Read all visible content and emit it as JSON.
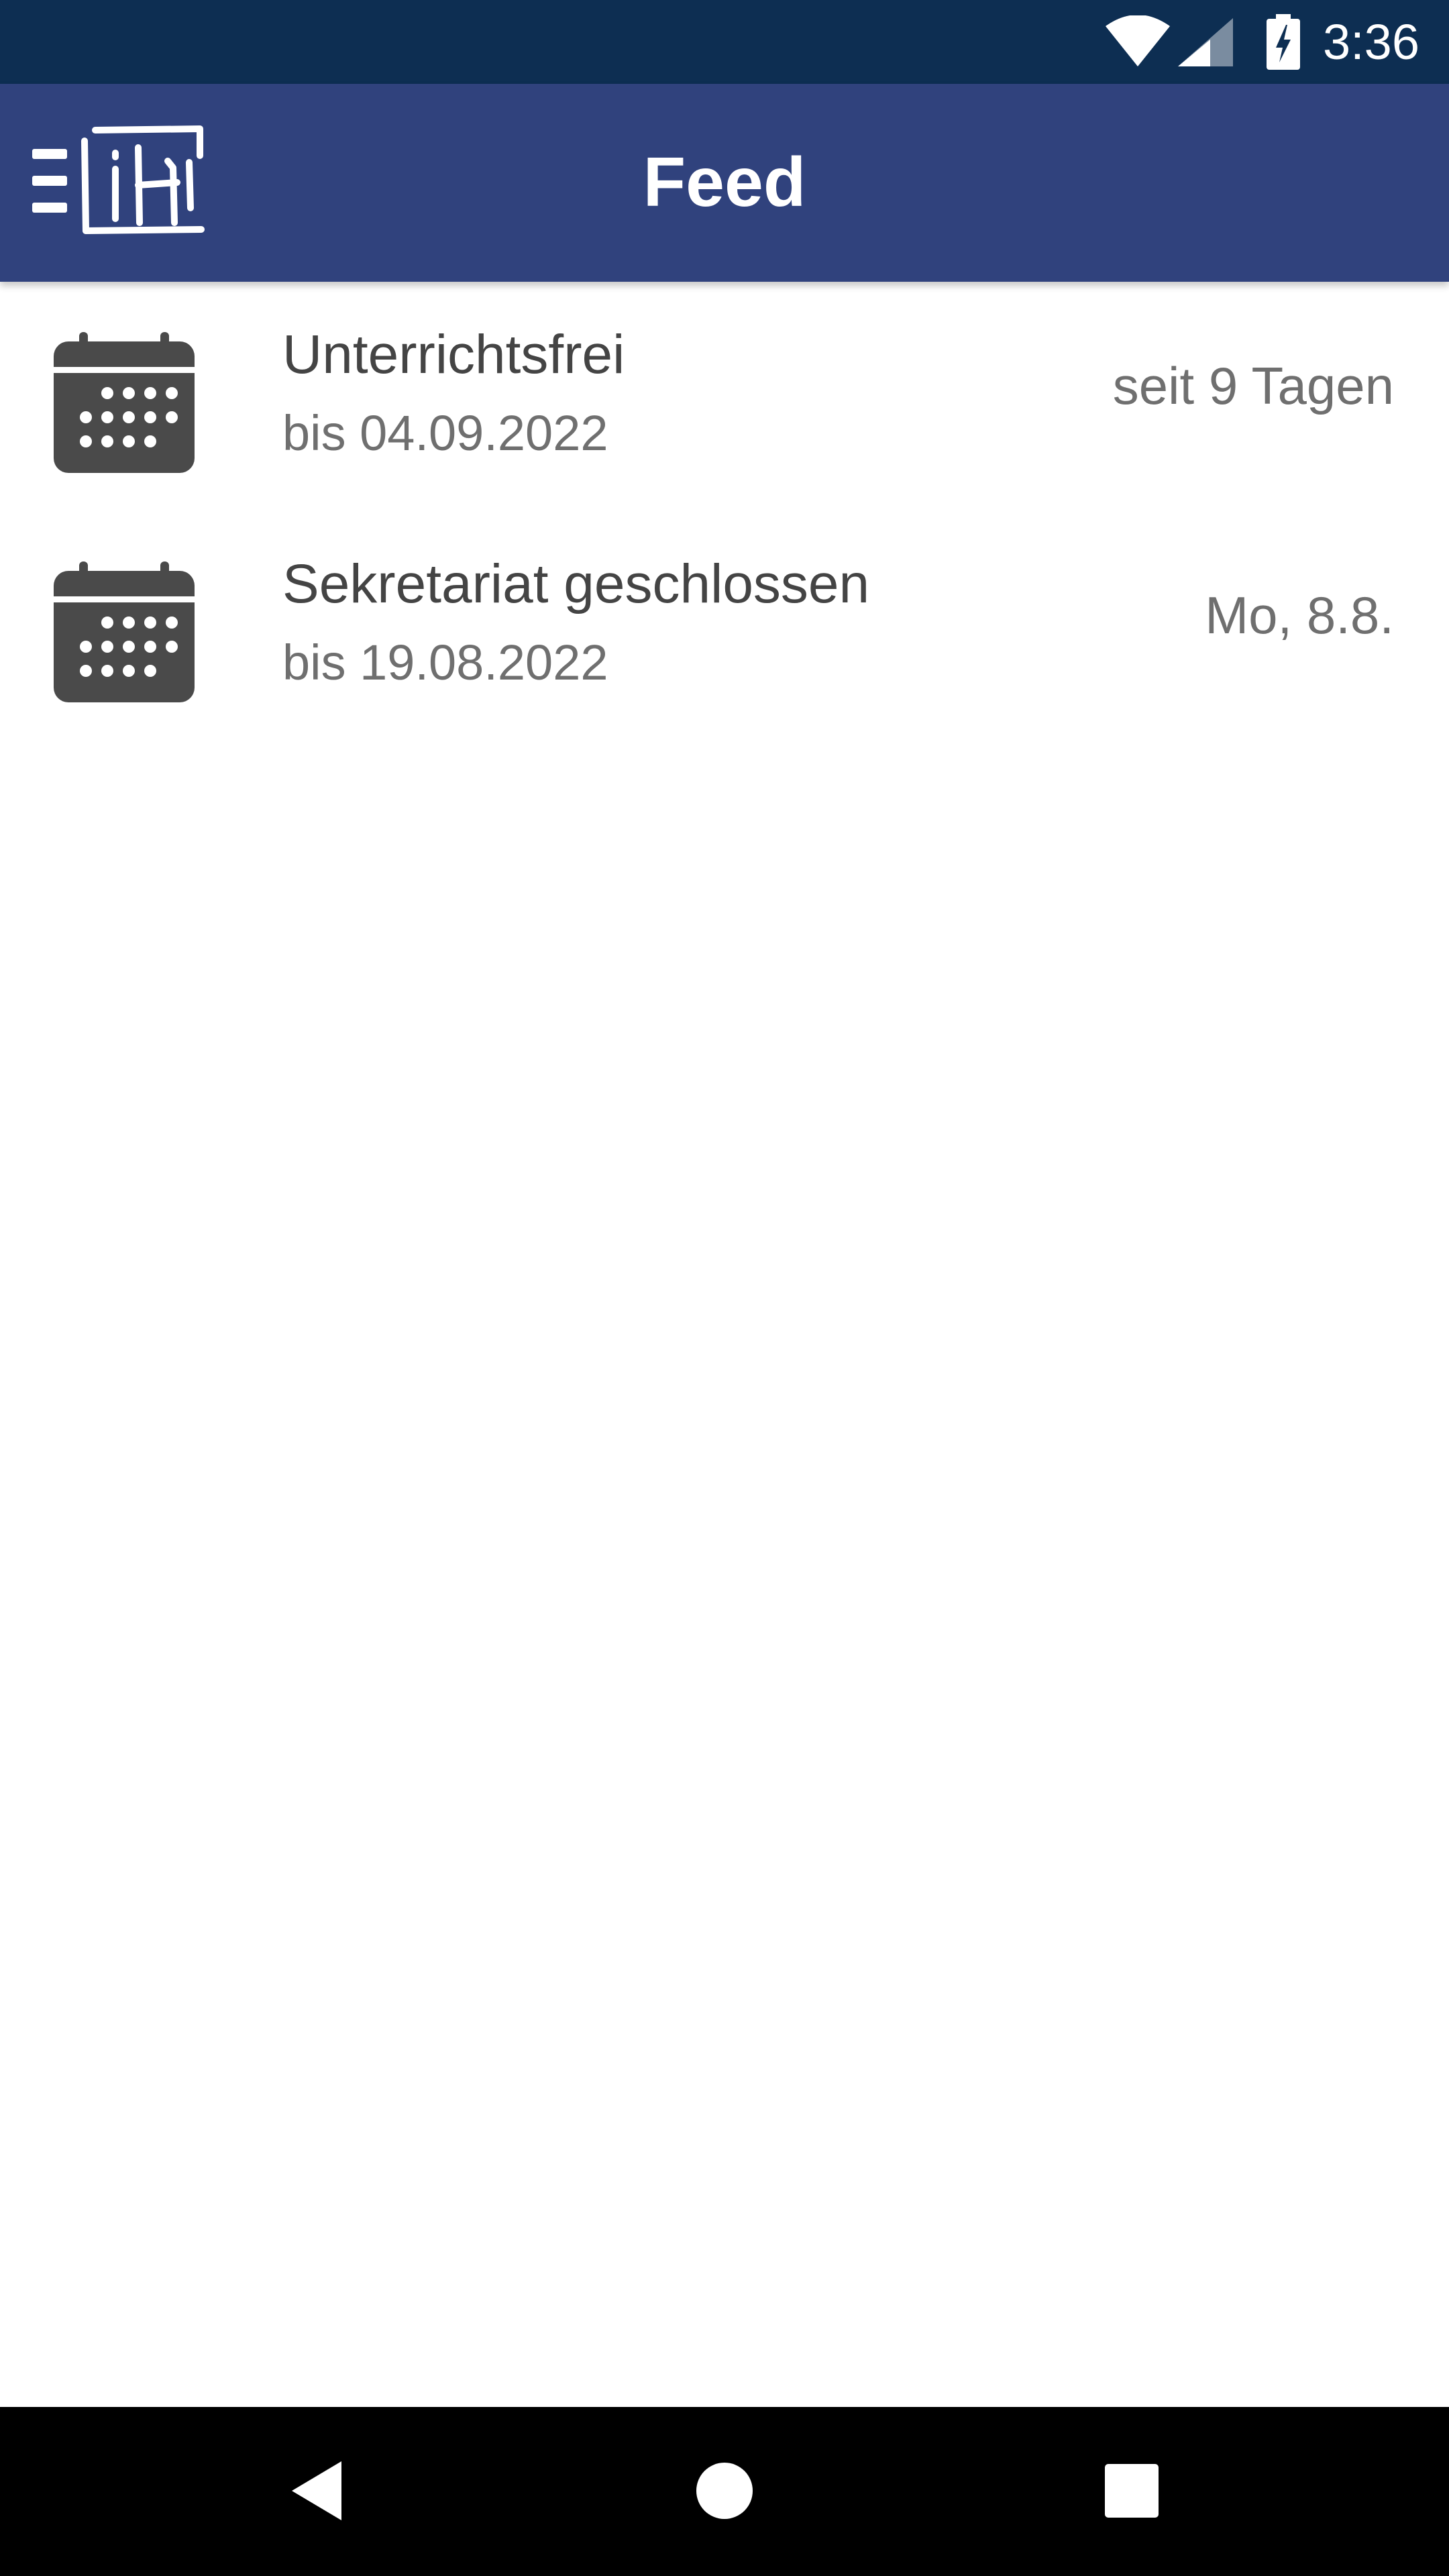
{
  "status_bar": {
    "time": "3:36",
    "icons": [
      "wifi-icon",
      "signal-icon",
      "battery-charging-icon"
    ]
  },
  "app_bar": {
    "title": "Feed",
    "menu_icon": "menu-icon",
    "logo": "school-logo"
  },
  "feed": {
    "items": [
      {
        "icon": "calendar-icon",
        "title": "Unterrichtsfrei",
        "subtitle": "bis 04.09.2022",
        "date": "seit 9 Tagen"
      },
      {
        "icon": "calendar-icon",
        "title": "Sekretariat geschlossen",
        "subtitle": "bis 19.08.2022",
        "date": "Mo, 8.8."
      }
    ]
  },
  "nav_bar": {
    "buttons": [
      "back-icon",
      "home-icon",
      "recents-icon"
    ]
  },
  "colors": {
    "status_bar": "#0d2e52",
    "app_bar": "#30427d",
    "icon": "#4a4a4a",
    "title_text": "#444444",
    "secondary_text": "#6f6f6f"
  }
}
